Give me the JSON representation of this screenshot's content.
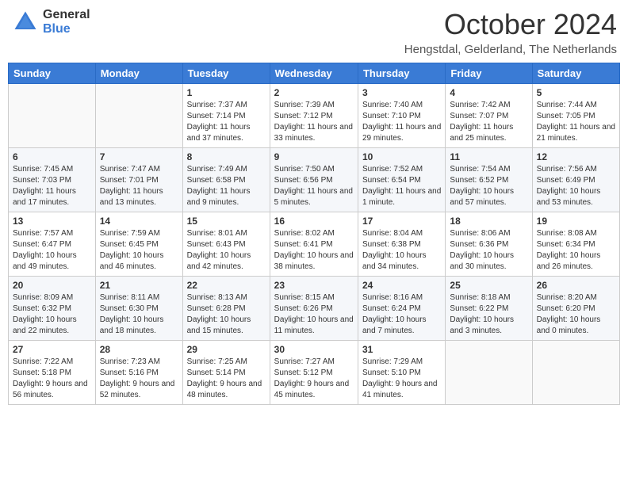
{
  "header": {
    "logo_general": "General",
    "logo_blue": "Blue",
    "month_title": "October 2024",
    "location": "Hengstdal, Gelderland, The Netherlands"
  },
  "days_of_week": [
    "Sunday",
    "Monday",
    "Tuesday",
    "Wednesday",
    "Thursday",
    "Friday",
    "Saturday"
  ],
  "weeks": [
    [
      {
        "day": "",
        "content": ""
      },
      {
        "day": "",
        "content": ""
      },
      {
        "day": "1",
        "content": "Sunrise: 7:37 AM\nSunset: 7:14 PM\nDaylight: 11 hours and 37 minutes."
      },
      {
        "day": "2",
        "content": "Sunrise: 7:39 AM\nSunset: 7:12 PM\nDaylight: 11 hours and 33 minutes."
      },
      {
        "day": "3",
        "content": "Sunrise: 7:40 AM\nSunset: 7:10 PM\nDaylight: 11 hours and 29 minutes."
      },
      {
        "day": "4",
        "content": "Sunrise: 7:42 AM\nSunset: 7:07 PM\nDaylight: 11 hours and 25 minutes."
      },
      {
        "day": "5",
        "content": "Sunrise: 7:44 AM\nSunset: 7:05 PM\nDaylight: 11 hours and 21 minutes."
      }
    ],
    [
      {
        "day": "6",
        "content": "Sunrise: 7:45 AM\nSunset: 7:03 PM\nDaylight: 11 hours and 17 minutes."
      },
      {
        "day": "7",
        "content": "Sunrise: 7:47 AM\nSunset: 7:01 PM\nDaylight: 11 hours and 13 minutes."
      },
      {
        "day": "8",
        "content": "Sunrise: 7:49 AM\nSunset: 6:58 PM\nDaylight: 11 hours and 9 minutes."
      },
      {
        "day": "9",
        "content": "Sunrise: 7:50 AM\nSunset: 6:56 PM\nDaylight: 11 hours and 5 minutes."
      },
      {
        "day": "10",
        "content": "Sunrise: 7:52 AM\nSunset: 6:54 PM\nDaylight: 11 hours and 1 minute."
      },
      {
        "day": "11",
        "content": "Sunrise: 7:54 AM\nSunset: 6:52 PM\nDaylight: 10 hours and 57 minutes."
      },
      {
        "day": "12",
        "content": "Sunrise: 7:56 AM\nSunset: 6:49 PM\nDaylight: 10 hours and 53 minutes."
      }
    ],
    [
      {
        "day": "13",
        "content": "Sunrise: 7:57 AM\nSunset: 6:47 PM\nDaylight: 10 hours and 49 minutes."
      },
      {
        "day": "14",
        "content": "Sunrise: 7:59 AM\nSunset: 6:45 PM\nDaylight: 10 hours and 46 minutes."
      },
      {
        "day": "15",
        "content": "Sunrise: 8:01 AM\nSunset: 6:43 PM\nDaylight: 10 hours and 42 minutes."
      },
      {
        "day": "16",
        "content": "Sunrise: 8:02 AM\nSunset: 6:41 PM\nDaylight: 10 hours and 38 minutes."
      },
      {
        "day": "17",
        "content": "Sunrise: 8:04 AM\nSunset: 6:38 PM\nDaylight: 10 hours and 34 minutes."
      },
      {
        "day": "18",
        "content": "Sunrise: 8:06 AM\nSunset: 6:36 PM\nDaylight: 10 hours and 30 minutes."
      },
      {
        "day": "19",
        "content": "Sunrise: 8:08 AM\nSunset: 6:34 PM\nDaylight: 10 hours and 26 minutes."
      }
    ],
    [
      {
        "day": "20",
        "content": "Sunrise: 8:09 AM\nSunset: 6:32 PM\nDaylight: 10 hours and 22 minutes."
      },
      {
        "day": "21",
        "content": "Sunrise: 8:11 AM\nSunset: 6:30 PM\nDaylight: 10 hours and 18 minutes."
      },
      {
        "day": "22",
        "content": "Sunrise: 8:13 AM\nSunset: 6:28 PM\nDaylight: 10 hours and 15 minutes."
      },
      {
        "day": "23",
        "content": "Sunrise: 8:15 AM\nSunset: 6:26 PM\nDaylight: 10 hours and 11 minutes."
      },
      {
        "day": "24",
        "content": "Sunrise: 8:16 AM\nSunset: 6:24 PM\nDaylight: 10 hours and 7 minutes."
      },
      {
        "day": "25",
        "content": "Sunrise: 8:18 AM\nSunset: 6:22 PM\nDaylight: 10 hours and 3 minutes."
      },
      {
        "day": "26",
        "content": "Sunrise: 8:20 AM\nSunset: 6:20 PM\nDaylight: 10 hours and 0 minutes."
      }
    ],
    [
      {
        "day": "27",
        "content": "Sunrise: 7:22 AM\nSunset: 5:18 PM\nDaylight: 9 hours and 56 minutes."
      },
      {
        "day": "28",
        "content": "Sunrise: 7:23 AM\nSunset: 5:16 PM\nDaylight: 9 hours and 52 minutes."
      },
      {
        "day": "29",
        "content": "Sunrise: 7:25 AM\nSunset: 5:14 PM\nDaylight: 9 hours and 48 minutes."
      },
      {
        "day": "30",
        "content": "Sunrise: 7:27 AM\nSunset: 5:12 PM\nDaylight: 9 hours and 45 minutes."
      },
      {
        "day": "31",
        "content": "Sunrise: 7:29 AM\nSunset: 5:10 PM\nDaylight: 9 hours and 41 minutes."
      },
      {
        "day": "",
        "content": ""
      },
      {
        "day": "",
        "content": ""
      }
    ]
  ]
}
